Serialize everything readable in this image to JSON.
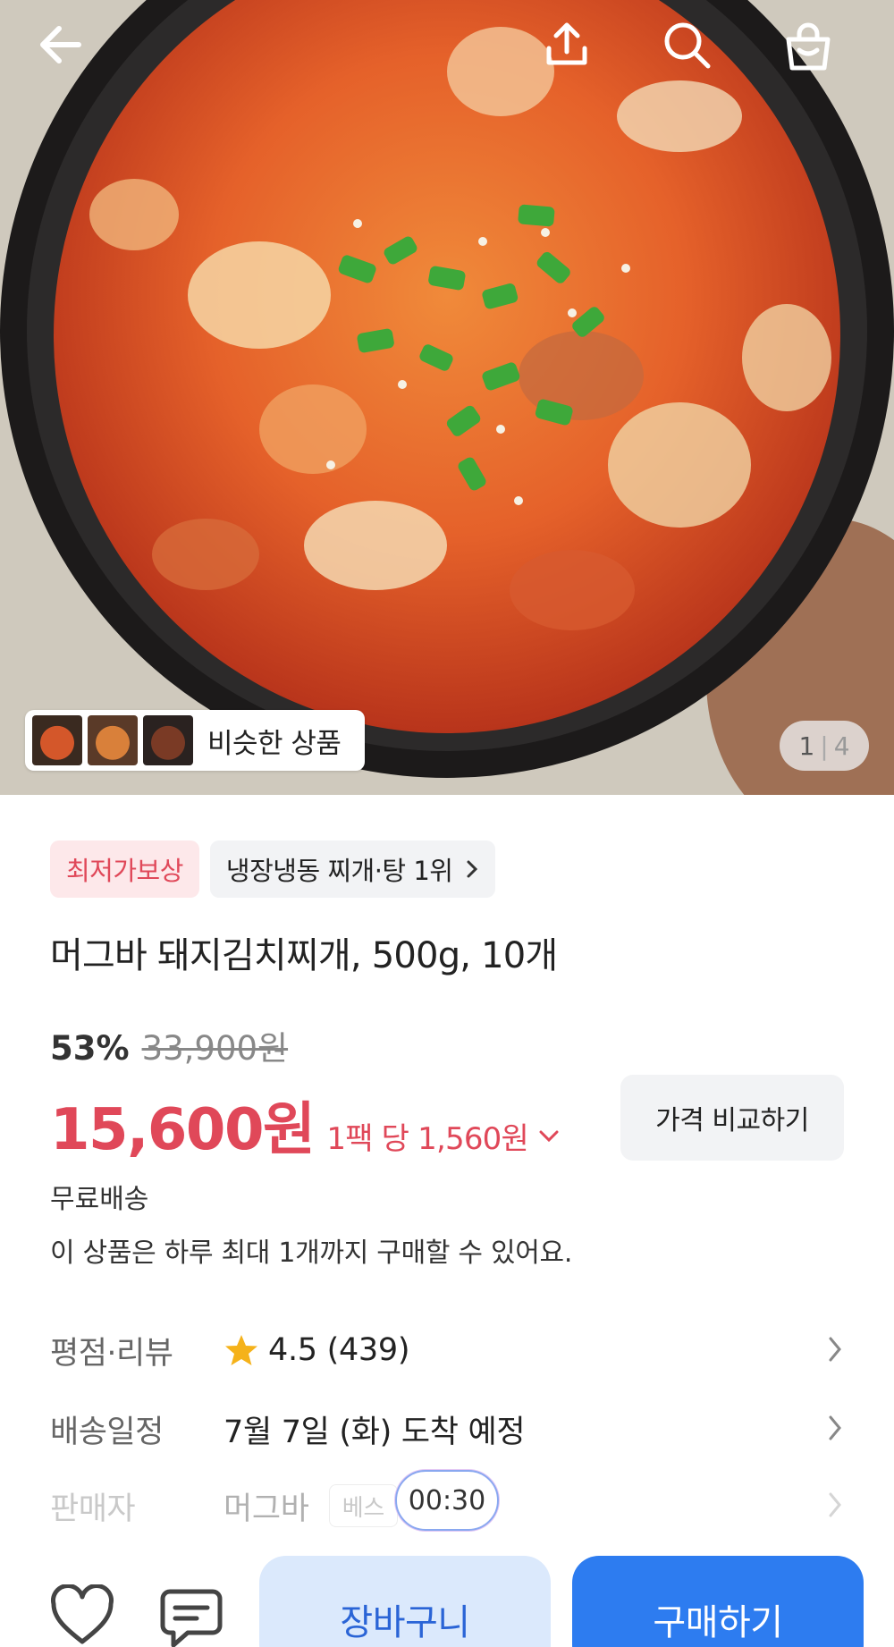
{
  "hero": {
    "similar_label": "비슷한 상품",
    "page_current": "1",
    "page_total": "4"
  },
  "badges": {
    "lowest_price": "최저가보상",
    "rank": "냉장냉동 찌개·탕 1위"
  },
  "product": {
    "title": "머그바 돼지김치찌개, 500g, 10개",
    "discount": "53%",
    "original_price": "33,900원",
    "price": "15,600원",
    "unit_price": "1팩 당 1,560원",
    "compare_label": "가격 비교하기",
    "shipping": "무료배송",
    "purchase_limit": "이 상품은 하루 최대 1개까지 구매할 수 있어요."
  },
  "info": {
    "rating_label": "평점·리뷰",
    "rating_value": "4.5 (439)",
    "delivery_label": "배송일정",
    "delivery_value": "7월 7일 (화) 도착 예정",
    "seller_label": "판매자",
    "seller_value": "머그바",
    "seller_tag": "베스"
  },
  "timer": "00:30",
  "bottom": {
    "cart_label": "장바구니",
    "buy_label": "구매하기"
  },
  "colors": {
    "accent_red": "#e04859",
    "accent_blue": "#2d7cf0",
    "star": "#f5b21a"
  }
}
